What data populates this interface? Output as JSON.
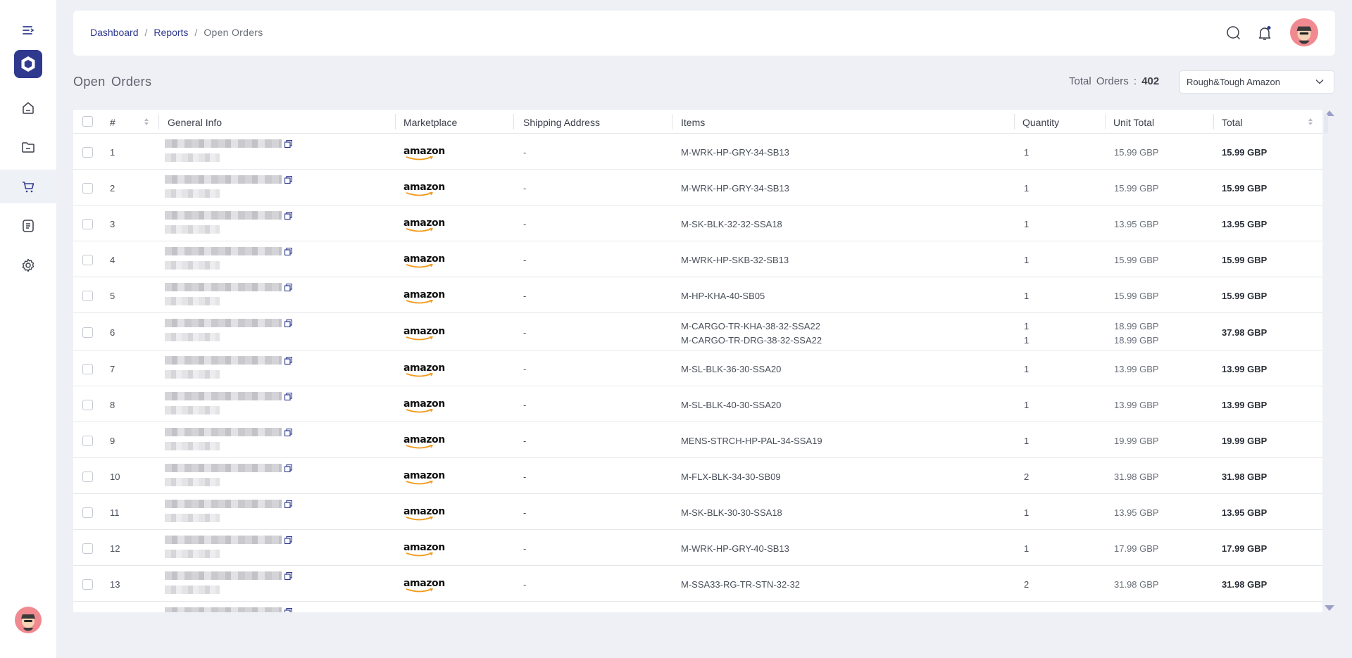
{
  "breadcrumb": {
    "items": [
      "Dashboard",
      "Reports",
      "Open  Orders"
    ],
    "separator": "/"
  },
  "page": {
    "title": "Open  Orders",
    "total_label": "Total  Orders :",
    "total_value": "402",
    "store": "Rough&Tough Amazon"
  },
  "table": {
    "columns": [
      "#",
      "General Info",
      "Marketplace",
      "Shipping Address",
      "Items",
      "Quantity",
      "Unit Total",
      "Total"
    ],
    "rows": [
      {
        "n": "1",
        "marketplace": "amazon",
        "address": "-",
        "items": [
          "M-WRK-HP-GRY-34-SB13"
        ],
        "qty": [
          "1"
        ],
        "unit": [
          "15.99 GBP"
        ],
        "total": "15.99 GBP"
      },
      {
        "n": "2",
        "marketplace": "amazon",
        "address": "-",
        "items": [
          "M-WRK-HP-GRY-34-SB13"
        ],
        "qty": [
          "1"
        ],
        "unit": [
          "15.99 GBP"
        ],
        "total": "15.99 GBP"
      },
      {
        "n": "3",
        "marketplace": "amazon",
        "address": "-",
        "items": [
          "M-SK-BLK-32-32-SSA18"
        ],
        "qty": [
          "1"
        ],
        "unit": [
          "13.95 GBP"
        ],
        "total": "13.95 GBP"
      },
      {
        "n": "4",
        "marketplace": "amazon",
        "address": "-",
        "items": [
          "M-WRK-HP-SKB-32-SB13"
        ],
        "qty": [
          "1"
        ],
        "unit": [
          "15.99 GBP"
        ],
        "total": "15.99 GBP"
      },
      {
        "n": "5",
        "marketplace": "amazon",
        "address": "-",
        "items": [
          "M-HP-KHA-40-SB05"
        ],
        "qty": [
          "1"
        ],
        "unit": [
          "15.99 GBP"
        ],
        "total": "15.99 GBP"
      },
      {
        "n": "6",
        "marketplace": "amazon",
        "address": "-",
        "items": [
          "M-CARGO-TR-KHA-38-32-SSA22",
          "M-CARGO-TR-DRG-38-32-SSA22"
        ],
        "qty": [
          "1",
          "1"
        ],
        "unit": [
          "18.99 GBP",
          "18.99 GBP"
        ],
        "total": "37.98 GBP"
      },
      {
        "n": "7",
        "marketplace": "amazon",
        "address": "-",
        "items": [
          "M-SL-BLK-36-30-SSA20"
        ],
        "qty": [
          "1"
        ],
        "unit": [
          "13.99 GBP"
        ],
        "total": "13.99 GBP"
      },
      {
        "n": "8",
        "marketplace": "amazon",
        "address": "-",
        "items": [
          "M-SL-BLK-40-30-SSA20"
        ],
        "qty": [
          "1"
        ],
        "unit": [
          "13.99 GBP"
        ],
        "total": "13.99 GBP"
      },
      {
        "n": "9",
        "marketplace": "amazon",
        "address": "-",
        "items": [
          "MENS-STRCH-HP-PAL-34-SSA19"
        ],
        "qty": [
          "1"
        ],
        "unit": [
          "19.99 GBP"
        ],
        "total": "19.99 GBP"
      },
      {
        "n": "10",
        "marketplace": "amazon",
        "address": "-",
        "items": [
          "M-FLX-BLK-34-30-SB09"
        ],
        "qty": [
          "2"
        ],
        "unit": [
          "31.98 GBP"
        ],
        "total": "31.98 GBP"
      },
      {
        "n": "11",
        "marketplace": "amazon",
        "address": "-",
        "items": [
          "M-SK-BLK-30-30-SSA18"
        ],
        "qty": [
          "1"
        ],
        "unit": [
          "13.95 GBP"
        ],
        "total": "13.95 GBP"
      },
      {
        "n": "12",
        "marketplace": "amazon",
        "address": "-",
        "items": [
          "M-WRK-HP-GRY-40-SB13"
        ],
        "qty": [
          "1"
        ],
        "unit": [
          "17.99 GBP"
        ],
        "total": "17.99 GBP"
      },
      {
        "n": "13",
        "marketplace": "amazon",
        "address": "-",
        "items": [
          "M-SSA33-RG-TR-STN-32-32"
        ],
        "qty": [
          "2"
        ],
        "unit": [
          "31.98 GBP"
        ],
        "total": "31.98 GBP"
      }
    ]
  },
  "colors": {
    "brand": "#2f3a8f",
    "link": "#2f3a8f",
    "avatar_bg": "#f08a90",
    "amazon_smile": "#f29b1b"
  },
  "icons": [
    "menu-toggle-icon",
    "logo-icon",
    "home-icon",
    "folder-icon",
    "cart-icon",
    "list-icon",
    "gear-icon",
    "search-icon",
    "bell-icon",
    "copy-icon",
    "chevron-down-icon",
    "sort-icon"
  ]
}
